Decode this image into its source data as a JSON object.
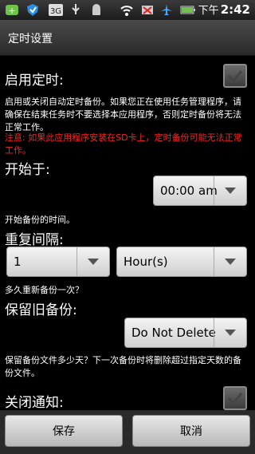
{
  "status_bar": {
    "icons": [
      "app-launcher-icon",
      "shield-icon",
      "3g-icon",
      "usb-icon",
      "android-icon",
      "wifi-icon",
      "signal-muted-icon",
      "airplane-icon",
      "battery-icon"
    ],
    "network": "3G",
    "time_prefix": "下午",
    "time": "2:42"
  },
  "title": "定时设置",
  "enable": {
    "label": "启用定时:",
    "checked": true,
    "description": "启用或关闭自动定时备份。如果您正在使用任务管理程序，请确保在结束任务时不要选择本应用程序，否则定时备份将无法正常工作。",
    "warning": "注意: 如果此应用程序安装在SD卡上，定时备份可能无法正常工作。"
  },
  "start": {
    "label": "开始于:",
    "value": "00:00 am",
    "description": "开始备份的时间。"
  },
  "repeat": {
    "label": "重复间隔:",
    "value": "1",
    "unit": "Hour(s)",
    "description": "多久重新备份一次？"
  },
  "keep": {
    "label": "保留旧备份:",
    "value": "Do Not Delete",
    "description": "保留备份文件多少天？下一次备份时将删除超过指定天数的备份文件。"
  },
  "notify": {
    "label": "关闭通知:",
    "checked": true
  },
  "buttons": {
    "save": "保存",
    "cancel": "取消"
  }
}
